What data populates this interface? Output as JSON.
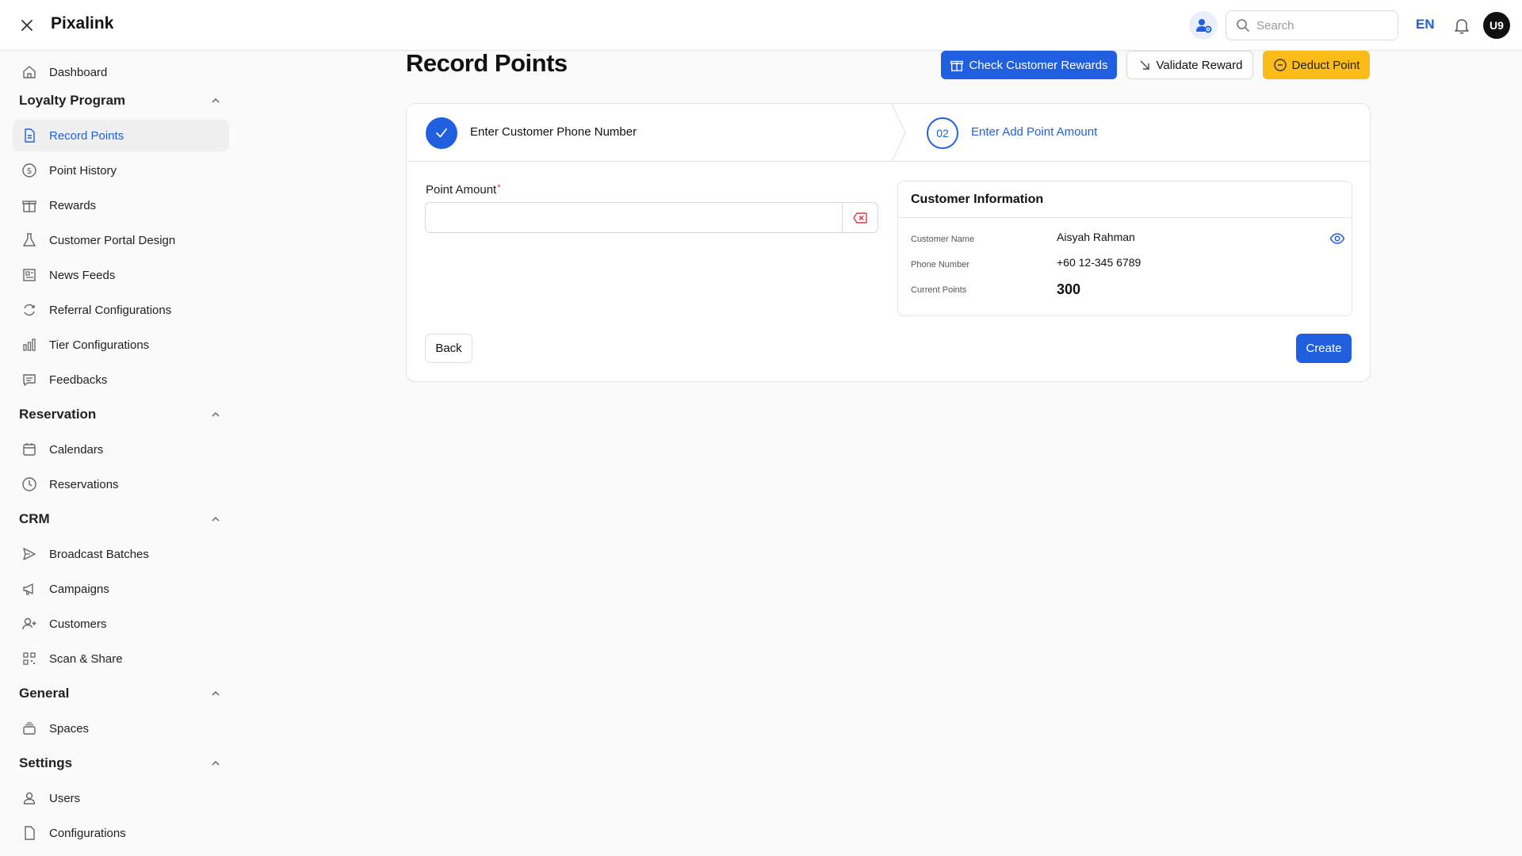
{
  "app": {
    "brand": "Pixalink"
  },
  "header": {
    "search_placeholder": "Search",
    "language": "EN",
    "avatar_initials": "U9"
  },
  "sidebar": {
    "dashboard": "Dashboard",
    "sections": {
      "loyalty": "Loyalty Program",
      "reservation": "Reservation",
      "crm": "CRM",
      "general": "General",
      "settings": "Settings"
    },
    "items": {
      "record_points": "Record Points",
      "point_history": "Point History",
      "rewards": "Rewards",
      "customer_portal_design": "Customer Portal Design",
      "news_feeds": "News Feeds",
      "referral_configurations": "Referral Configurations",
      "tier_configurations": "Tier Configurations",
      "feedbacks": "Feedbacks",
      "calendars": "Calendars",
      "reservations": "Reservations",
      "broadcast_batches": "Broadcast Batches",
      "campaigns": "Campaigns",
      "customers": "Customers",
      "scan_share": "Scan & Share",
      "spaces": "Spaces",
      "users": "Users",
      "configurations": "Configurations"
    },
    "active": "record_points"
  },
  "page": {
    "title": "Record Points",
    "actions": {
      "check_rewards": "Check Customer Rewards",
      "validate_reward": "Validate Reward",
      "deduct_point": "Deduct Point"
    }
  },
  "stepper": {
    "step1": {
      "label": "Enter Customer Phone Number",
      "status": "completed"
    },
    "step2": {
      "number": "02",
      "label": "Enter Add Point Amount",
      "status": "current"
    }
  },
  "form": {
    "point_amount_label": "Point Amount",
    "required_mark": "*",
    "point_amount_value": ""
  },
  "customer_info": {
    "title": "Customer Information",
    "name_label": "Customer Name",
    "name_value": "Aisyah Rahman",
    "phone_label": "Phone Number",
    "phone_value": "+60 12-345 6789",
    "points_label": "Current Points",
    "points_value": "300"
  },
  "footer_buttons": {
    "back": "Back",
    "create": "Create"
  },
  "colors": {
    "primary": "#1f5fe0",
    "warning": "#fbbc17",
    "danger": "#e0313b"
  }
}
